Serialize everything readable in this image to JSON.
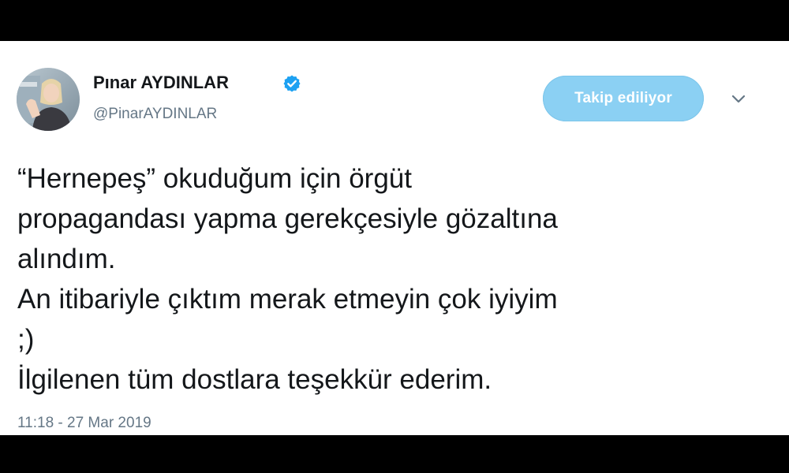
{
  "author": {
    "display_name": "Pınar AYDINLAR",
    "handle": "@PinarAYDINLAR",
    "verified": true
  },
  "follow_button": {
    "label": "Takip ediliyor"
  },
  "tweet": {
    "lines": [
      "“Hernepeş” okuduğum için örgüt",
      "propagandası yapma gerekçesiyle gözaltına",
      "alındım.",
      "An itibariyle çıktım merak etmeyin çok iyiyim",
      ";)",
      "İlgilenen tüm dostlara teşekkür ederim."
    ],
    "timestamp": "11:18 - 27 Mar 2019"
  },
  "colors": {
    "verified_badge": "#1da1f2",
    "follow_button_bg": "#8bd0f3",
    "secondary_text": "#657786",
    "primary_text": "#14171a"
  },
  "icons": {
    "verified": "verified-badge-icon",
    "more": "chevron-down-icon"
  }
}
